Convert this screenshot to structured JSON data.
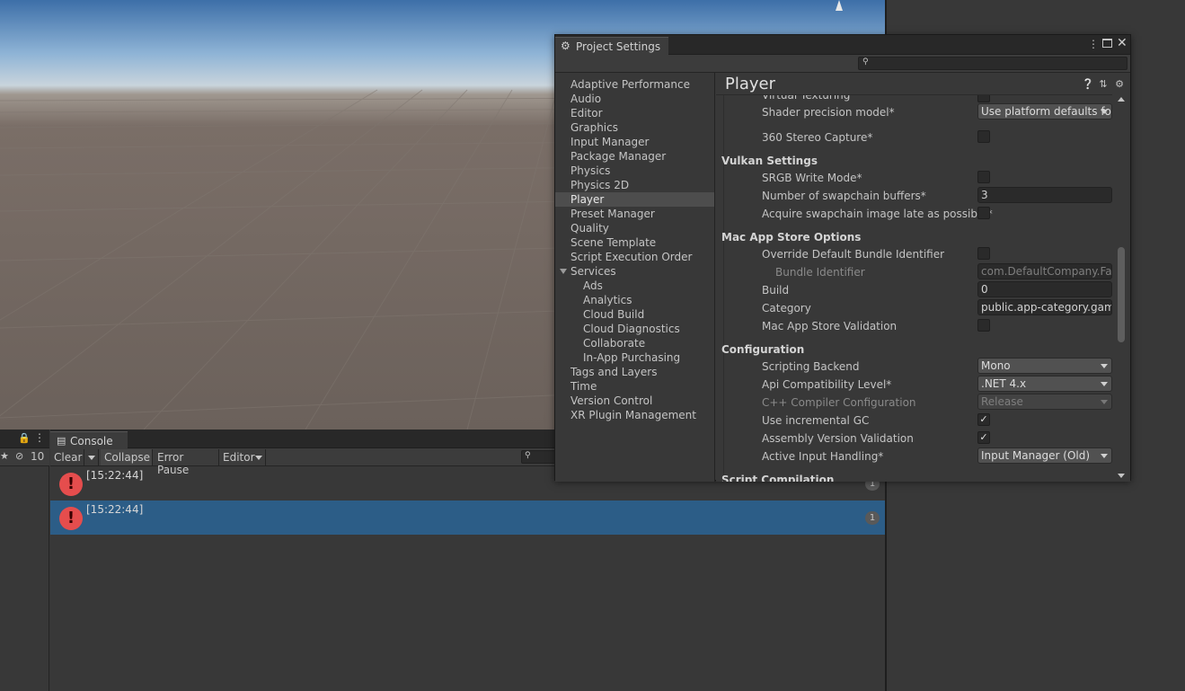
{
  "scene": {
    "sky_top_color": "#3d6fa8",
    "ground_color": "#6b615b"
  },
  "left_strip": {
    "hidden_count": "10",
    "lock_icon": "lock-icon",
    "menu_icon": "kebab-menu-icon"
  },
  "console": {
    "tab_label": "Console",
    "toolbar": {
      "clear": "Clear",
      "collapse": "Collapse",
      "error_pause": "Error Pause",
      "editor": "Editor"
    },
    "logs": [
      {
        "time": "[15:22:44]",
        "count": "1",
        "selected": false
      },
      {
        "time": "[15:22:44]",
        "count": "1",
        "selected": true
      }
    ],
    "error_color": "#e54d4d",
    "selected_color": "#2c5d87"
  },
  "project_settings": {
    "title": "Project Settings",
    "nav": [
      {
        "label": "Adaptive Performance",
        "sub": false
      },
      {
        "label": "Audio",
        "sub": false
      },
      {
        "label": "Editor",
        "sub": false
      },
      {
        "label": "Graphics",
        "sub": false
      },
      {
        "label": "Input Manager",
        "sub": false
      },
      {
        "label": "Package Manager",
        "sub": false
      },
      {
        "label": "Physics",
        "sub": false
      },
      {
        "label": "Physics 2D",
        "sub": false
      },
      {
        "label": "Player",
        "sub": false,
        "selected": true
      },
      {
        "label": "Preset Manager",
        "sub": false
      },
      {
        "label": "Quality",
        "sub": false
      },
      {
        "label": "Scene Template",
        "sub": false
      },
      {
        "label": "Script Execution Order",
        "sub": false
      },
      {
        "label": "Services",
        "sub": false,
        "expanded": true
      },
      {
        "label": "Ads",
        "sub": true
      },
      {
        "label": "Analytics",
        "sub": true
      },
      {
        "label": "Cloud Build",
        "sub": true
      },
      {
        "label": "Cloud Diagnostics",
        "sub": true
      },
      {
        "label": "Collaborate",
        "sub": true
      },
      {
        "label": "In-App Purchasing",
        "sub": true
      },
      {
        "label": "Tags and Layers",
        "sub": false
      },
      {
        "label": "Time",
        "sub": false
      },
      {
        "label": "Version Control",
        "sub": false
      },
      {
        "label": "XR Plugin Management",
        "sub": false
      }
    ],
    "heading": "Player",
    "props": {
      "virtual_texturing": "Virtual Texturing",
      "shader_precision_label": "Shader precision model*",
      "shader_precision_value": "Use platform defaults fo",
      "stereo_capture_label": "360 Stereo Capture*",
      "vulkan_header": "Vulkan Settings",
      "srgb_label": "SRGB Write Mode*",
      "swapchain_label": "Number of swapchain buffers*",
      "swapchain_value": "3",
      "acquire_label": "Acquire swapchain image late as possible*",
      "mac_header": "Mac App Store Options",
      "override_bundle_label": "Override Default Bundle Identifier",
      "bundle_id_label": "Bundle Identifier",
      "bundle_id_value": "com.DefaultCompany.Fan",
      "build_label": "Build",
      "build_value": "0",
      "category_label": "Category",
      "category_value": "public.app-category.game",
      "mac_validation_label": "Mac App Store Validation",
      "config_header": "Configuration",
      "scripting_backend_label": "Scripting Backend",
      "scripting_backend_value": "Mono",
      "api_level_label": "Api Compatibility Level*",
      "api_level_value": ".NET 4.x",
      "cpp_config_label": "C++ Compiler Configuration",
      "cpp_config_value": "Release",
      "incremental_gc_label": "Use incremental GC",
      "incremental_gc_checked": true,
      "assembly_validation_label": "Assembly Version Validation",
      "assembly_validation_checked": true,
      "input_handling_label": "Active Input Handling*",
      "input_handling_value": "Input Manager (Old)",
      "script_compilation_header": "Script Compilation"
    }
  }
}
